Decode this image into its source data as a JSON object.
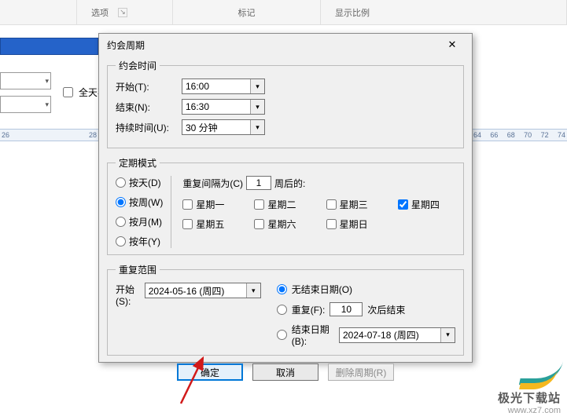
{
  "ribbon": {
    "groups": [
      "选项",
      "标记",
      "显示比例"
    ],
    "launcher_glyph": "↘"
  },
  "left": {
    "all_day_label": "全天事",
    "ruler_left": [
      "26",
      "28"
    ],
    "ruler_right": [
      "64",
      "66",
      "68",
      "70",
      "72",
      "74"
    ]
  },
  "dialog": {
    "title": "约会周期",
    "close_glyph": "✕",
    "time": {
      "legend": "约会时间",
      "start_label": "开始(T):",
      "start_value": "16:00",
      "end_label": "结束(N):",
      "end_value": "16:30",
      "duration_label": "持续时间(U):",
      "duration_value": "30 分钟"
    },
    "pattern": {
      "legend": "定期模式",
      "daily": "按天(D)",
      "weekly": "按周(W)",
      "monthly": "按月(M)",
      "yearly": "按年(Y)",
      "every_prefix": "重复间隔为(C)",
      "every_value": "1",
      "every_suffix": "周后的:",
      "days": {
        "mon": "星期一",
        "tue": "星期二",
        "wed": "星期三",
        "thu": "星期四",
        "fri": "星期五",
        "sat": "星期六",
        "sun": "星期日"
      },
      "checked_day": "thu"
    },
    "range": {
      "legend": "重复范围",
      "start_label": "开始(S):",
      "start_value": "2024-05-16 (周四)",
      "no_end": "无结束日期(O)",
      "after_prefix": "重复(F):",
      "after_value": "10",
      "after_suffix": "次后结束",
      "end_by_prefix": "结束日期(B):",
      "end_by_value": "2024-07-18 (周四)"
    },
    "buttons": {
      "ok": "确定",
      "cancel": "取消",
      "remove": "删除周期(R)"
    }
  },
  "watermark": {
    "line1": "极光下载站",
    "line2": "www.xz7.com"
  },
  "colors": {
    "accent": "#0078d7",
    "annotation": "#d11a1a"
  }
}
